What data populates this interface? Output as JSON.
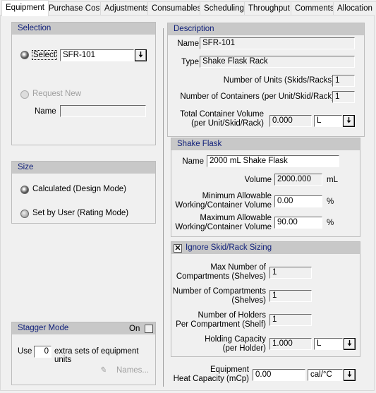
{
  "tabs": [
    "Equipment",
    "Purchase Cost",
    "Adjustments",
    "Consumables",
    "Scheduling",
    "Throughput",
    "Comments",
    "Allocation"
  ],
  "selection": {
    "title": "Selection",
    "select_label": "Select",
    "select_value": "SFR-101",
    "request_new_label": "Request New",
    "name_label": "Name",
    "name_value": ""
  },
  "size": {
    "title": "Size",
    "calculated": "Calculated (Design Mode)",
    "set_by_user": "Set by User (Rating Mode)",
    "selected": "calculated"
  },
  "stagger": {
    "title": "Stagger Mode",
    "on_label": "On",
    "on_checked": false,
    "use_label": "Use",
    "extra_sets": "0",
    "extra_label": "extra sets of equipment units",
    "names_button": "Names..."
  },
  "description": {
    "title": "Description",
    "name_label": "Name",
    "name_value": "SFR-101",
    "type_label": "Type",
    "type_value": "Shake Flask Rack",
    "units_label": "Number of Units (Skids/Racks)",
    "units_value": "1",
    "containers_label": "Number of Containers (per Unit/Skid/Rack)",
    "containers_value": "1",
    "total_vol_label1": "Total Container Volume",
    "total_vol_label2": "(per Unit/Skid/Rack)",
    "total_vol_value": "0.000",
    "total_vol_unit": "L"
  },
  "shake_flask": {
    "title": "Shake Flask",
    "name_label": "Name",
    "name_value": "2000 mL Shake Flask",
    "volume_label": "Volume",
    "volume_value": "2000.000",
    "volume_unit": "mL",
    "min_label1": "Minimum Allowable",
    "min_label2": "Working/Container Volume",
    "min_value": "0.00",
    "min_unit": "%",
    "max_label1": "Maximum Allowable",
    "max_label2": "Working/Container Volume",
    "max_value": "90.00",
    "max_unit": "%"
  },
  "skid": {
    "title": "Ignore Skid/Rack Sizing",
    "checked": true,
    "max_comp_label1": "Max Number of",
    "max_comp_label2": "Compartments (Shelves)",
    "max_comp_value": "1",
    "num_comp_label1": "Number of Compartments",
    "num_comp_label2": "(Shelves)",
    "num_comp_value": "1",
    "holders_label1": "Number of Holders",
    "holders_label2": "Per Compartment (Shelf)",
    "holders_value": "1",
    "hold_cap_label1": "Holding Capacity",
    "hold_cap_label2": "(per Holder)",
    "hold_cap_value": "1.000",
    "hold_cap_unit": "L"
  },
  "heat": {
    "label1": "Equipment",
    "label2": "Heat Capacity (mCp)",
    "value": "0.00",
    "unit": "cal/°C"
  }
}
